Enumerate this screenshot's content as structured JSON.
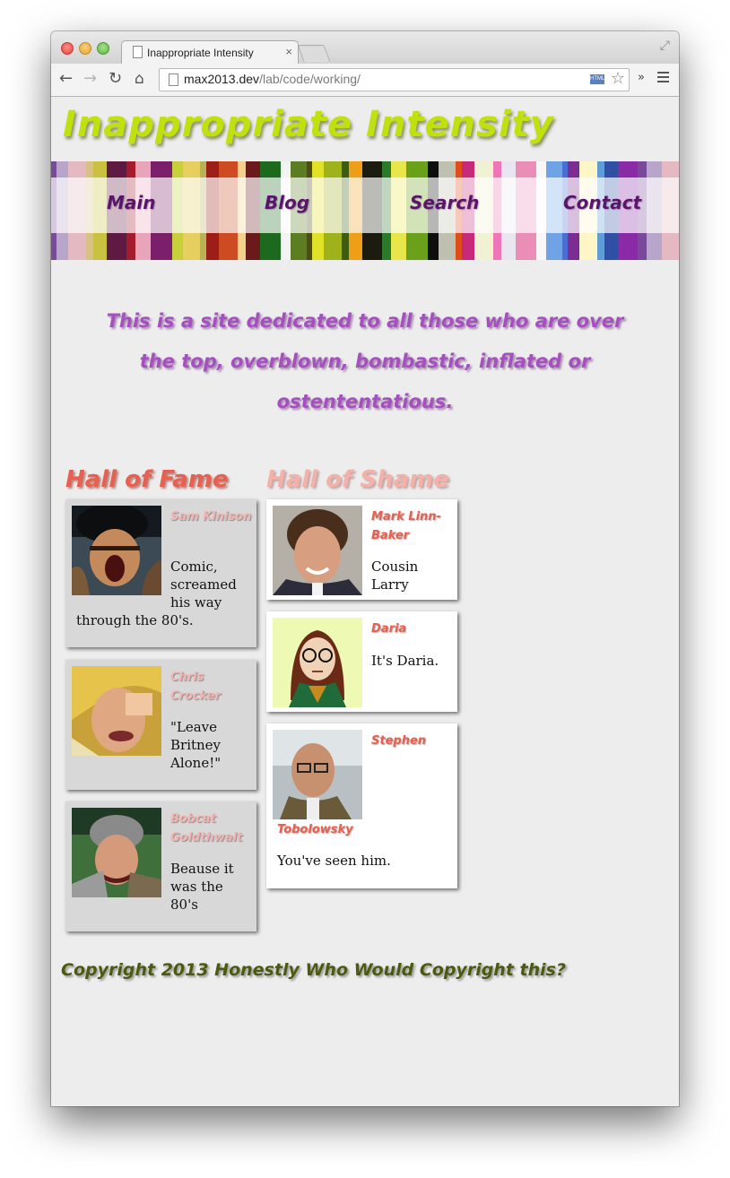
{
  "browser": {
    "tab_title": "Inappropriate Intensity",
    "tab_close": "×",
    "url_host": "max2013.dev",
    "url_path": "/lab/code/working/",
    "overflow": "»",
    "html5_badge": "HTML"
  },
  "site": {
    "brand": "Inappropriate Intensity",
    "nav": [
      {
        "label": "Main"
      },
      {
        "label": "Blog"
      },
      {
        "label": "Search"
      },
      {
        "label": "Contact"
      }
    ],
    "tagline": "This is a site dedicated to all those who are over the top, overblown, bombastic, inflated or ostententatious.",
    "fame": {
      "heading": "Hall of Fame",
      "entries": [
        {
          "name": "Sam Kinison",
          "desc_a": "Comic, screamed his way",
          "desc_b": "through the 80's."
        },
        {
          "name": "Chris Crocker",
          "desc_a": "\"Leave Britney Alone!\""
        },
        {
          "name": "Bobcat Goldthwait",
          "desc_a": "Beause it was the 80's"
        }
      ]
    },
    "shame": {
      "heading": "Hall of Shame",
      "entries": [
        {
          "name": "Mark Linn-Baker",
          "desc_a": "Cousin Larry"
        },
        {
          "name": "Daria",
          "desc_a": "It's Daria."
        },
        {
          "name": "Stephen",
          "name_b": "Tobolowsky",
          "desc_a": "You've seen him."
        }
      ]
    },
    "footer": "Copyright 2013 Honestly Who Would Copyright this?"
  },
  "colors": {
    "brand": "#c1e10f",
    "nav_text": "#5b146b",
    "tagline": "#a64fc0",
    "fame_heading": "#e8604f",
    "shame_heading": "#f4b1a8",
    "footer": "#4b5a0f",
    "page_bg": "#ededed"
  },
  "icons": [
    "back-arrow-icon",
    "forward-arrow-icon",
    "reload-icon",
    "home-icon",
    "page-icon",
    "star-icon",
    "menu-icon",
    "fullscreen-icon"
  ]
}
